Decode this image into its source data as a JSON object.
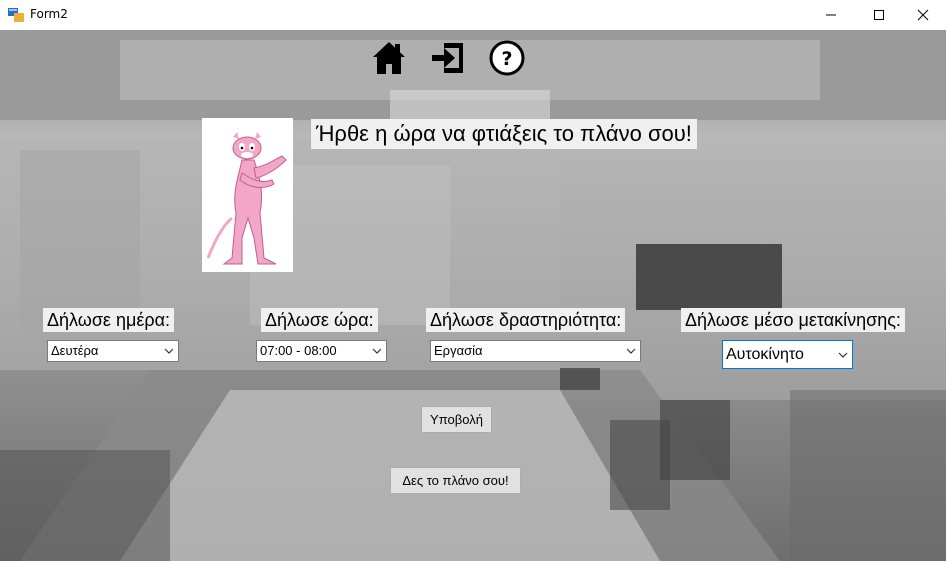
{
  "window": {
    "title": "Form2",
    "icon": "winforms-app-icon",
    "controls": [
      "minimize-icon",
      "maximize-icon",
      "close-icon"
    ]
  },
  "toolbar": {
    "icons": [
      "home-icon",
      "exit-icon",
      "help-icon"
    ]
  },
  "header": {
    "image": "pink-panther-image",
    "text": "Ήρθε η ώρα να φτιάξεις το πλάνο σου!"
  },
  "form": {
    "day_label": "Δήλωσε ημέρα:",
    "day_value": "Δευτέρα",
    "time_label": "Δήλωσε ώρα:",
    "time_value": "07:00 - 08:00",
    "activity_label": "Δήλωσε δραστηριότητα:",
    "activity_value": "Εργασία",
    "transport_label": "Δήλωσε μέσο μετακίνησης:",
    "transport_value": "Αυτοκίνητο"
  },
  "actions": {
    "submit_label": "Υποβολή",
    "view_plan_label": "Δες το πλάνο σου!"
  },
  "colors": {
    "label_bg": "#f0f0f0",
    "focus_border": "#0078d7"
  }
}
